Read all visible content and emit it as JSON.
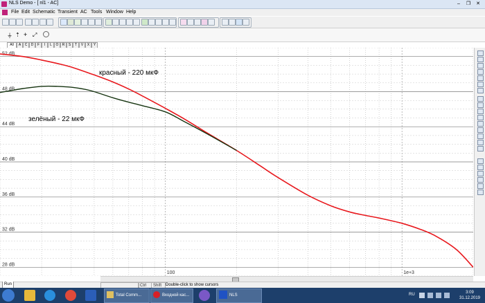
{
  "window": {
    "title": "NLS Demo - [ nl1 - AC]",
    "minimize": "–",
    "maximize": "❐",
    "close": "✕"
  },
  "menu": [
    "File",
    "Edit",
    "Schematic",
    "Transient",
    "AC",
    "Tools",
    "Window",
    "Help"
  ],
  "tabs": [
    "All",
    "A",
    "C",
    "D",
    "F",
    "I",
    "L",
    "O",
    "R",
    "S",
    "T",
    "V",
    "X",
    "Y"
  ],
  "chart_data": {
    "type": "line",
    "x_scale": "log",
    "xlim": [
      20,
      2000
    ],
    "ylim": [
      27,
      53
    ],
    "y_ticks": [
      28,
      32,
      36,
      40,
      44,
      48,
      52
    ],
    "y_tick_labels": [
      "28 dB",
      "32 dB",
      "36 dB",
      "40 dB",
      "44 dB",
      "48 dB",
      "52 dB"
    ],
    "x_tick_labels": [
      {
        "x": 100,
        "label": "100"
      },
      {
        "x": 1000,
        "label": "1e+3"
      }
    ],
    "grid": true,
    "series": [
      {
        "name": "красный - 220 мкФ",
        "color": "#e8171c",
        "x": [
          20,
          25,
          30,
          35,
          40,
          50,
          60,
          70,
          80,
          100,
          120,
          150,
          200,
          250,
          300,
          400,
          500,
          600,
          700,
          800,
          1000,
          1200,
          1400,
          1700,
          2000
        ],
        "y": [
          52.3,
          52.0,
          51.6,
          51.2,
          50.8,
          49.9,
          49.1,
          48.3,
          47.5,
          46.1,
          44.9,
          43.3,
          41.3,
          39.6,
          38.2,
          36.2,
          35.0,
          34.3,
          33.9,
          33.6,
          33.0,
          32.3,
          31.5,
          30.0,
          28.0
        ]
      },
      {
        "name": "зелёный - 22 мкФ",
        "color": "#15330f",
        "x": [
          20,
          22,
          25,
          30,
          35,
          40,
          45,
          50,
          60,
          70,
          80,
          100,
          120,
          150,
          200
        ],
        "y": [
          47.9,
          48.1,
          48.35,
          48.6,
          48.6,
          48.5,
          48.3,
          48.0,
          47.3,
          46.8,
          46.4,
          45.7,
          44.6,
          43.2,
          41.3
        ]
      }
    ]
  },
  "annotations": {
    "red_label": "красный - 220 мкФ",
    "green_label": "зелёный - 22 мкФ"
  },
  "status": {
    "run_tab": "Run",
    "ctrl": "Ctrl",
    "shift": "Shift",
    "hint": "Double-click to show cursors"
  },
  "taskbar": {
    "tasks": [
      "Total Comm...",
      "Входной кас...",
      "NLS"
    ],
    "lang": "RU",
    "time": "3:09",
    "date": "31.12.2019"
  }
}
